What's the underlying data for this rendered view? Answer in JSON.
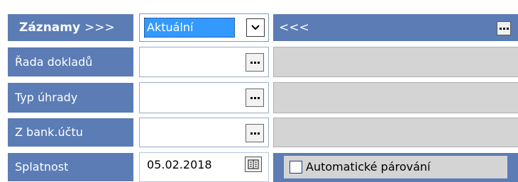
{
  "header": {
    "records_label": "Záznamy",
    "records_arrows": ">>>",
    "combo_value": "Aktuální",
    "right_arrows": "<<<"
  },
  "rows": [
    {
      "label": "Řada dokladů"
    },
    {
      "label": "Typ úhrady"
    },
    {
      "label": "Z bank.účtu"
    }
  ],
  "due": {
    "label": "Splatnost",
    "date_value": "05.02.2018"
  },
  "auto_pairing": {
    "label": "Automatické párování",
    "checked": false
  },
  "colors": {
    "header_bg": "#5b7cb5",
    "selection": "#3399ff",
    "disabled_bg": "#d4d4d4"
  },
  "icons": {
    "combo_dropdown": "chevron-down-icon",
    "picker": "ellipsis-icon",
    "calendar": "calendar-icon"
  }
}
